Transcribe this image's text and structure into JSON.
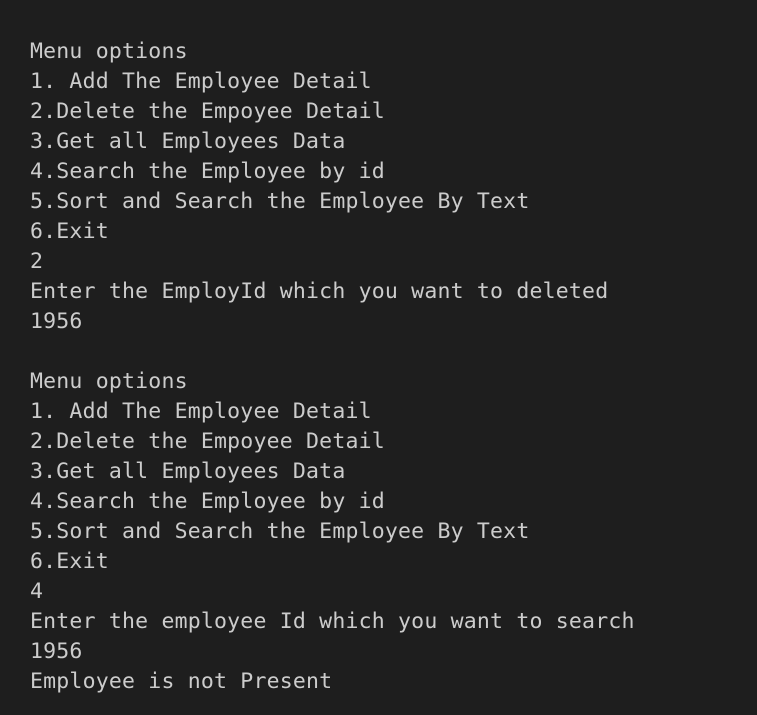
{
  "terminal": {
    "lines": [
      "Menu options",
      "1. Add The Employee Detail",
      "2.Delete the Empoyee Detail",
      "3.Get all Employees Data",
      "4.Search the Employee by id",
      "5.Sort and Search the Employee By Text",
      "6.Exit",
      "2",
      "Enter the EmployId which you want to deleted",
      "1956",
      "",
      "Menu options",
      "1. Add The Employee Detail",
      "2.Delete the Empoyee Detail",
      "3.Get all Employees Data",
      "4.Search the Employee by id",
      "5.Sort and Search the Employee By Text",
      "6.Exit",
      "4",
      "Enter the employee Id which you want to search",
      "1956",
      "Employee is not Present"
    ]
  }
}
